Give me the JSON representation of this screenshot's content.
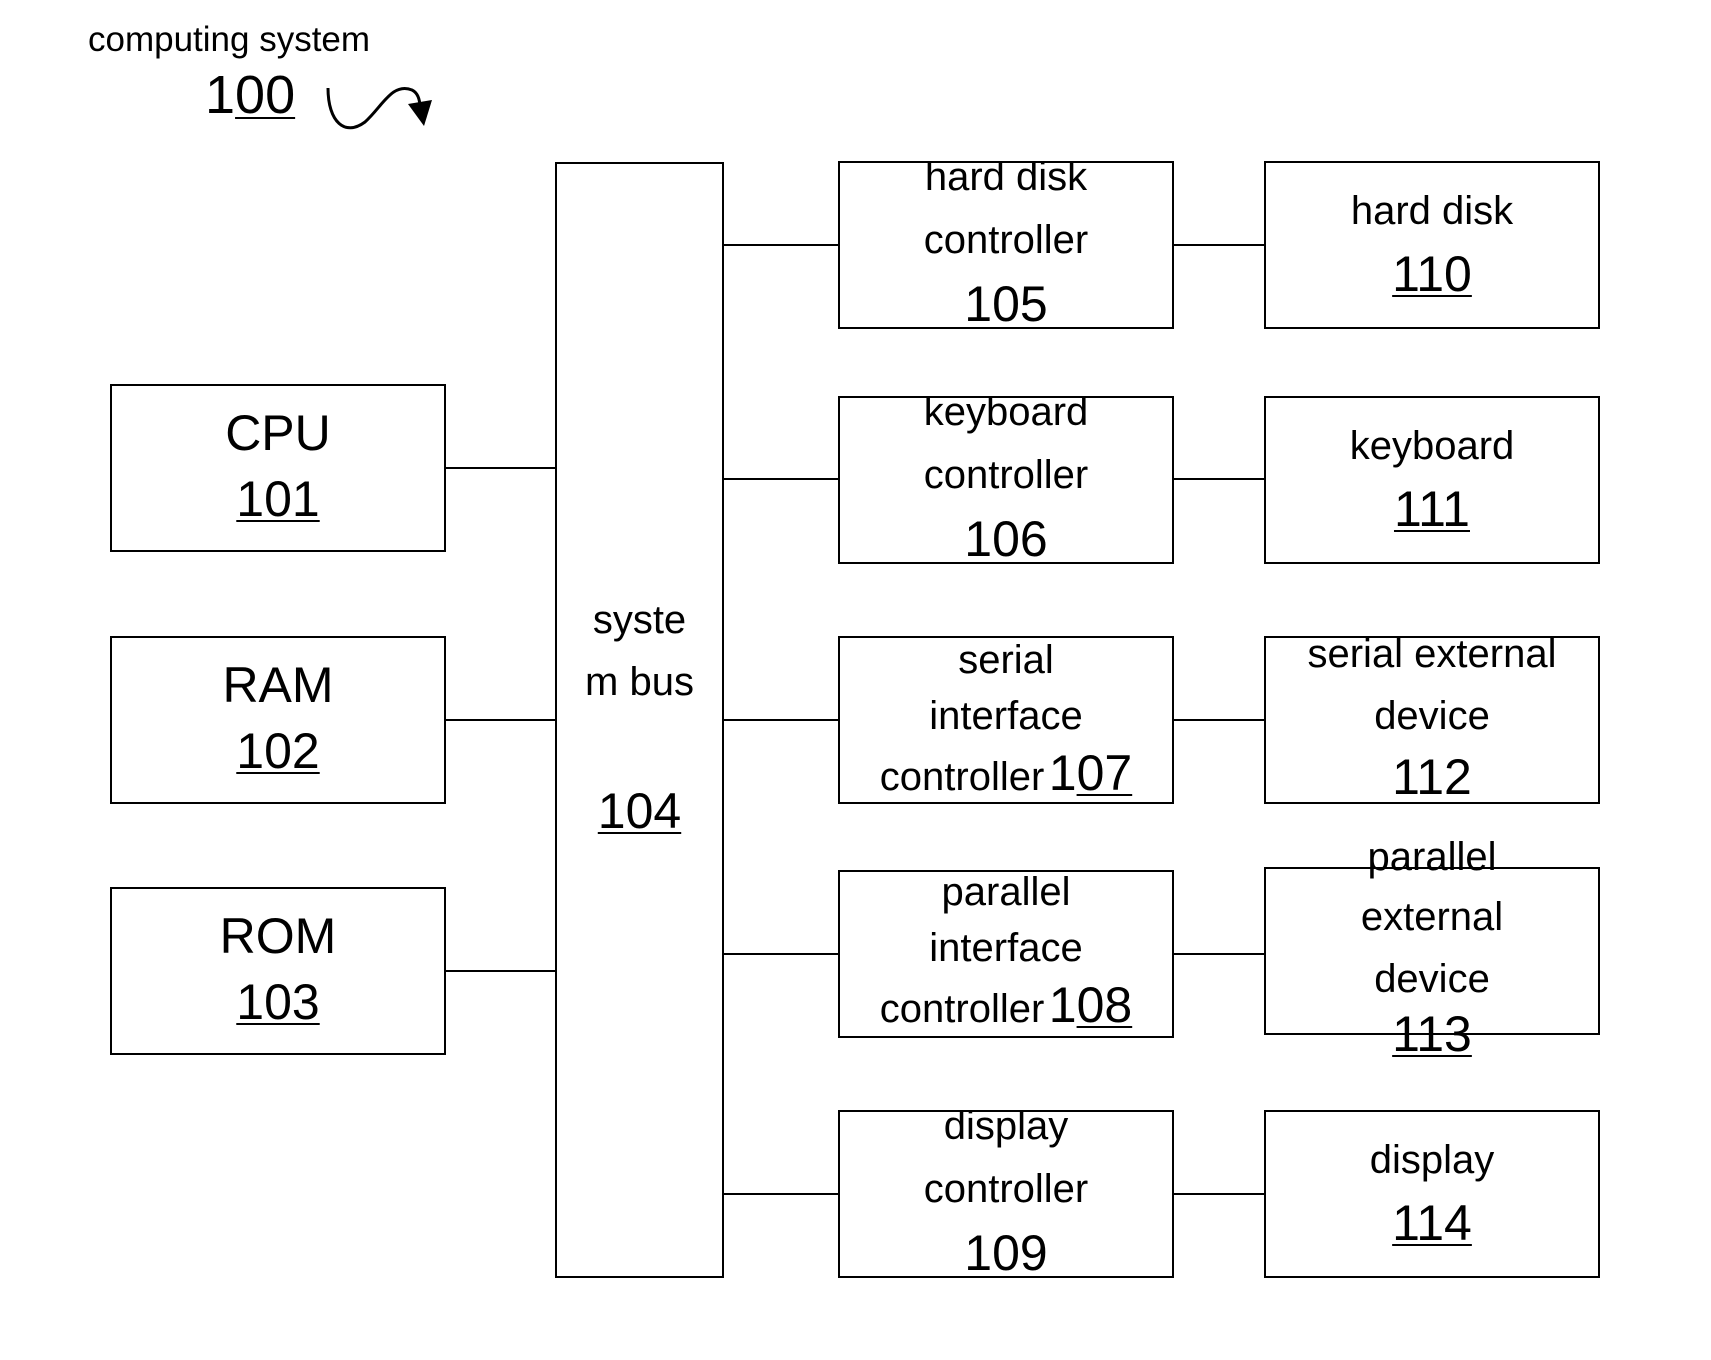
{
  "figure": {
    "title": "computing system",
    "ref": "100",
    "ref_prefix": "1",
    "ref_underlined": "00"
  },
  "left": {
    "cpu": {
      "name": "CPU",
      "ref": "101"
    },
    "ram": {
      "name": "RAM",
      "ref": "102"
    },
    "rom": {
      "name": "ROM",
      "ref": "103"
    }
  },
  "bus": {
    "line1": "syste",
    "line2": "m bus",
    "ref": "104"
  },
  "controllers": {
    "hdc": {
      "line1": "hard disk",
      "line2": "controller",
      "ref": "105"
    },
    "kbc": {
      "line1": "keyboard",
      "line2": "controller",
      "ref": "106"
    },
    "sic": {
      "line1": "serial",
      "line2": "interface",
      "line3": "controller",
      "ref_prefix": "1",
      "ref_underlined": "07"
    },
    "pic": {
      "line1": "parallel",
      "line2": "interface",
      "line3": "controller",
      "ref_prefix": "1",
      "ref_underlined": "08"
    },
    "dc": {
      "line1": "display",
      "line2": "controller",
      "ref": "109"
    }
  },
  "devices": {
    "hd": {
      "line1": "hard disk",
      "ref": "110"
    },
    "kb": {
      "line1": "keyboard",
      "ref": "111"
    },
    "sed": {
      "line1": "serial external",
      "line2": "device",
      "ref": "112"
    },
    "ped": {
      "line1": "parallel",
      "line2": "external",
      "line3": "device",
      "ref": "113"
    },
    "disp": {
      "line1": "display",
      "ref": "114"
    }
  }
}
